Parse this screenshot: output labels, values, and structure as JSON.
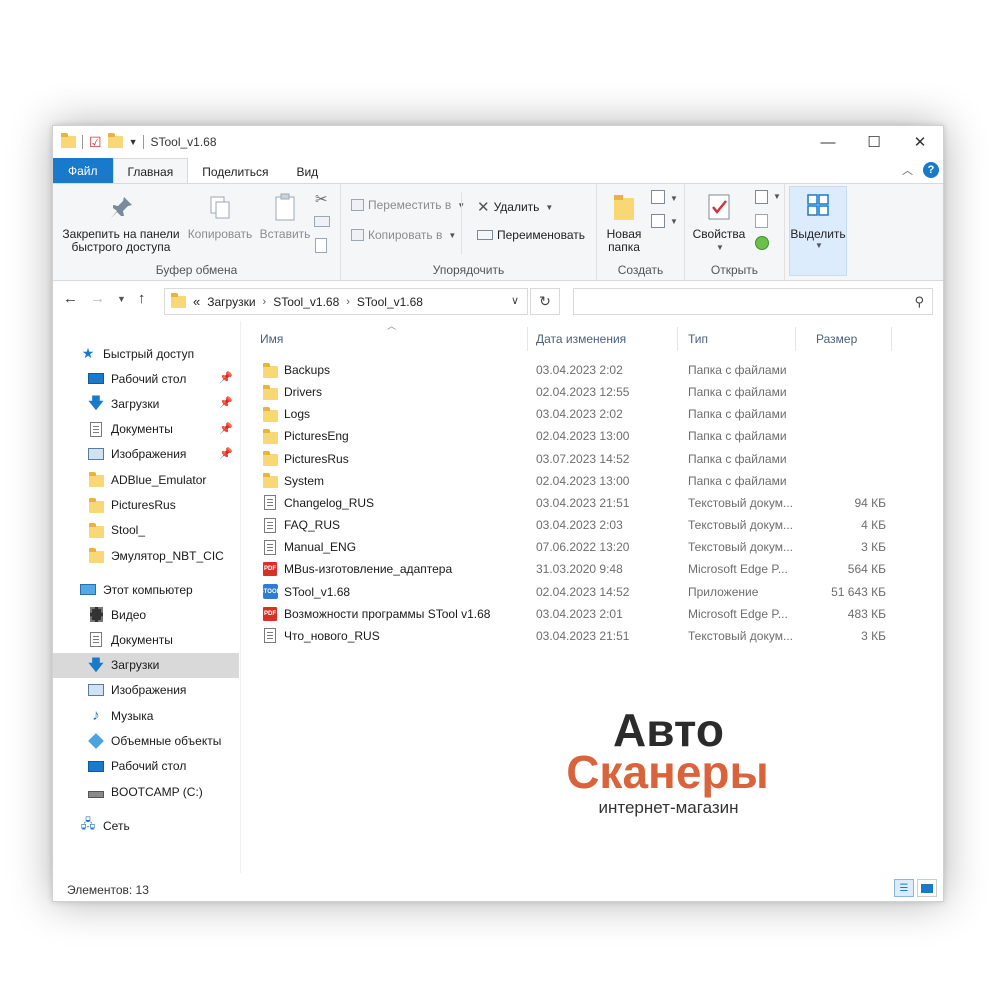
{
  "window": {
    "title": "STool_v1.68"
  },
  "titlebar": {
    "minimize": "—",
    "maximize": "☐",
    "close": "✕"
  },
  "tabs": [
    {
      "label": "Файл"
    },
    {
      "label": "Главная"
    },
    {
      "label": "Поделиться"
    },
    {
      "label": "Вид"
    }
  ],
  "ribbon": {
    "clipboard": {
      "label": "Буфер обмена",
      "pin_label_1": "Закрепить на панели",
      "pin_label_2": "быстрого доступа",
      "copy": "Копировать",
      "paste": "Вставить"
    },
    "organize": {
      "label": "Упорядочить",
      "move_to": "Переместить в",
      "copy_to": "Копировать в",
      "delete": "Удалить",
      "rename": "Переименовать"
    },
    "create": {
      "label": "Создать",
      "new_folder_1": "Новая",
      "new_folder_2": "папка"
    },
    "open": {
      "label": "Открыть",
      "properties": "Свойства"
    },
    "select": {
      "label": "Выделить"
    }
  },
  "address": {
    "overflow": "«",
    "path": [
      "Загрузки",
      "STool_v1.68",
      "STool_v1.68"
    ]
  },
  "nav": {
    "quick_access": "Быстрый доступ",
    "quick_items": [
      {
        "label": "Рабочий стол",
        "icon": "desktop-icon",
        "pinned": true
      },
      {
        "label": "Загрузки",
        "icon": "downloads-icon",
        "pinned": true
      },
      {
        "label": "Документы",
        "icon": "documents-icon",
        "pinned": true
      },
      {
        "label": "Изображения",
        "icon": "pictures-icon",
        "pinned": true
      },
      {
        "label": "ADBlue_Emulator",
        "icon": "folder-icon",
        "pinned": false
      },
      {
        "label": "PicturesRus",
        "icon": "folder-icon",
        "pinned": false
      },
      {
        "label": "Stool_",
        "icon": "folder-icon",
        "pinned": false
      },
      {
        "label": "Эмулятор_NBT_CIC",
        "icon": "folder-icon",
        "pinned": false
      }
    ],
    "this_pc": "Этот компьютер",
    "pc_items": [
      {
        "label": "Видео",
        "icon": "videos-icon"
      },
      {
        "label": "Документы",
        "icon": "documents-icon"
      },
      {
        "label": "Загрузки",
        "icon": "downloads-icon",
        "selected": true
      },
      {
        "label": "Изображения",
        "icon": "pictures-icon"
      },
      {
        "label": "Музыка",
        "icon": "music-icon"
      },
      {
        "label": "Объемные объекты",
        "icon": "3d-objects-icon"
      },
      {
        "label": "Рабочий стол",
        "icon": "desktop-icon"
      },
      {
        "label": "BOOTCAMP (C:)",
        "icon": "drive-icon"
      }
    ],
    "network": "Сеть"
  },
  "columns": {
    "name": "Имя",
    "date": "Дата изменения",
    "type": "Тип",
    "size": "Размер"
  },
  "files": [
    {
      "name": "Backups",
      "date": "03.04.2023 2:02",
      "type": "Папка с файлами",
      "size": "",
      "icon": "folder"
    },
    {
      "name": "Drivers",
      "date": "02.04.2023 12:55",
      "type": "Папка с файлами",
      "size": "",
      "icon": "folder"
    },
    {
      "name": "Logs",
      "date": "03.04.2023 2:02",
      "type": "Папка с файлами",
      "size": "",
      "icon": "folder"
    },
    {
      "name": "PicturesEng",
      "date": "02.04.2023 13:00",
      "type": "Папка с файлами",
      "size": "",
      "icon": "folder"
    },
    {
      "name": "PicturesRus",
      "date": "03.07.2023 14:52",
      "type": "Папка с файлами",
      "size": "",
      "icon": "folder"
    },
    {
      "name": "System",
      "date": "02.04.2023 13:00",
      "type": "Папка с файлами",
      "size": "",
      "icon": "folder"
    },
    {
      "name": "Changelog_RUS",
      "date": "03.04.2023 21:51",
      "type": "Текстовый докум...",
      "size": "94 КБ",
      "icon": "text"
    },
    {
      "name": "FAQ_RUS",
      "date": "03.04.2023 2:03",
      "type": "Текстовый докум...",
      "size": "4 КБ",
      "icon": "text"
    },
    {
      "name": "Manual_ENG",
      "date": "07.06.2022 13:20",
      "type": "Текстовый докум...",
      "size": "3 КБ",
      "icon": "text"
    },
    {
      "name": "MBus-изготовление_адаптера",
      "date": "31.03.2020 9:48",
      "type": "Microsoft Edge P...",
      "size": "564 КБ",
      "icon": "pdf"
    },
    {
      "name": "STool_v1.68",
      "date": "02.04.2023 14:52",
      "type": "Приложение",
      "size": "51 643 КБ",
      "icon": "app"
    },
    {
      "name": "Возможности программы STool v1.68",
      "date": "03.04.2023 2:01",
      "type": "Microsoft Edge P...",
      "size": "483 КБ",
      "icon": "pdf"
    },
    {
      "name": "Что_нового_RUS",
      "date": "03.04.2023 21:51",
      "type": "Текстовый докум...",
      "size": "3 КБ",
      "icon": "text"
    }
  ],
  "status": {
    "items_count": "Элементов: 13"
  },
  "watermark": {
    "line1": "Авто",
    "line2": "Сканеры",
    "line3": "интернет-магазин"
  },
  "icon_labels": {
    "pdf": "PDF",
    "app": "STOOL"
  },
  "colors": {
    "accent": "#1979ca",
    "brand_orange": "#d9633a",
    "folder": "#f8d775"
  }
}
